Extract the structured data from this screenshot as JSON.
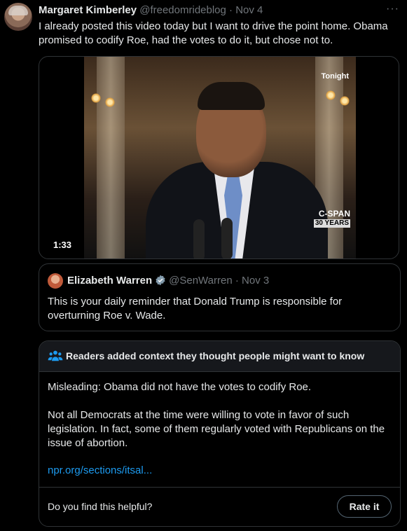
{
  "tweet": {
    "author_name": "Margaret Kimberley",
    "handle": "@freedomrideblog",
    "separator": " · ",
    "date": "Nov 4",
    "more_icon": "more-horizontal-icon",
    "text": "I already posted this video today but I want to drive the point home. Obama promised to codify Roe, had the votes to do it, but chose not to."
  },
  "video": {
    "duration": "1:33",
    "overlay_top": "Tonight",
    "overlay_logo": "C-SPAN",
    "overlay_logo_sub": "30 YEARS"
  },
  "quoted_tweet": {
    "author_name": "Elizabeth Warren",
    "verified_icon": "verified-badge-icon",
    "handle": "@SenWarren",
    "separator": " · ",
    "date": "Nov 3",
    "text": "This is your daily reminder that Donald Trump is responsible for overturning Roe v. Wade."
  },
  "community_note": {
    "icon": "people-icon",
    "title": "Readers added context they thought people might want to know",
    "paragraph1": "Misleading: Obama did not have the votes to codify Roe.",
    "paragraph2": "Not all Democrats at the time were willing to vote in favor of such legislation. In fact, some of them regularly voted with Republicans on the issue of abortion.",
    "link": "npr.org/sections/itsal...",
    "question": "Do you find this helpful?",
    "rate_button": "Rate it"
  },
  "colors": {
    "background": "#000000",
    "text": "#e7e9ea",
    "muted": "#71767b",
    "link": "#1d9bf0",
    "border": "#2f3336",
    "verified": "#829aab"
  }
}
